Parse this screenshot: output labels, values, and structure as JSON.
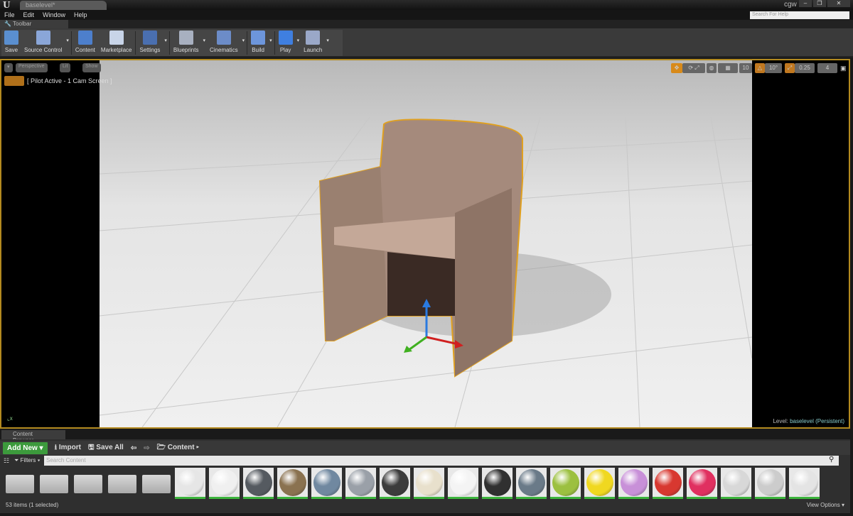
{
  "window": {
    "doc_tab": "baselevel*",
    "user": "cgw",
    "help_placeholder": "Search For Help",
    "min": "–",
    "max": "❐",
    "close": "✕"
  },
  "menu": [
    "File",
    "Edit",
    "Window",
    "Help"
  ],
  "toolbar_tab": "Toolbar",
  "toolbar": [
    {
      "label": "Save",
      "color": "#5a8fd0",
      "dd": false
    },
    {
      "label": "Source Control",
      "color": "#8aa6d8",
      "dd": true
    },
    {
      "label": "Content",
      "color": "#4d7fcc",
      "dd": false
    },
    {
      "label": "Marketplace",
      "color": "#c8d4e8",
      "dd": false
    },
    {
      "label": "Settings",
      "color": "#4a6fb0",
      "dd": true
    },
    {
      "label": "Blueprints",
      "color": "#a8b0c0",
      "dd": true
    },
    {
      "label": "Cinematics",
      "color": "#6c8cc8",
      "dd": true
    },
    {
      "label": "Build",
      "color": "#6d96dc",
      "dd": true
    },
    {
      "label": "Play",
      "color": "#3f7fe0",
      "dd": true
    },
    {
      "label": "Launch",
      "color": "#9aa8c8",
      "dd": true
    }
  ],
  "viewport": {
    "perspective": "Perspective",
    "lit": "Lit",
    "show": "Show",
    "pilot": "[ Pilot Active - 1 Cam Screen ]",
    "grid_snap": "10",
    "rot_snap": "10°",
    "scale_snap": "0.25",
    "cam_speed": "4",
    "level_label": "Level:",
    "level_name": "baselevel (Persistent)"
  },
  "content_browser": {
    "tab": "Content Browser",
    "add_new": "Add New ▾",
    "import": "Import",
    "save_all": "Save All",
    "path": "Content",
    "filters": "Filters ▾",
    "search_placeholder": "Search Content",
    "status": "53 items (1 selected)",
    "view_options": "View Options ▾",
    "folders": 5,
    "materials": [
      "#e6e6e6",
      "#f0f0f0",
      "#555a60",
      "#8a7250",
      "#7088a0",
      "#9aa0a8",
      "#3c3c3c",
      "#e8e0cc",
      "#f4f4f4",
      "#303030",
      "#6a7a88",
      "#9cc040",
      "#f0d820",
      "#c890d8",
      "#d83830",
      "#e03060",
      "#d8d8d8",
      "#cccccc",
      "#e4e4e4"
    ]
  },
  "colors": {
    "accent": "#b38a1f",
    "add_new": "#3c9a3c"
  }
}
